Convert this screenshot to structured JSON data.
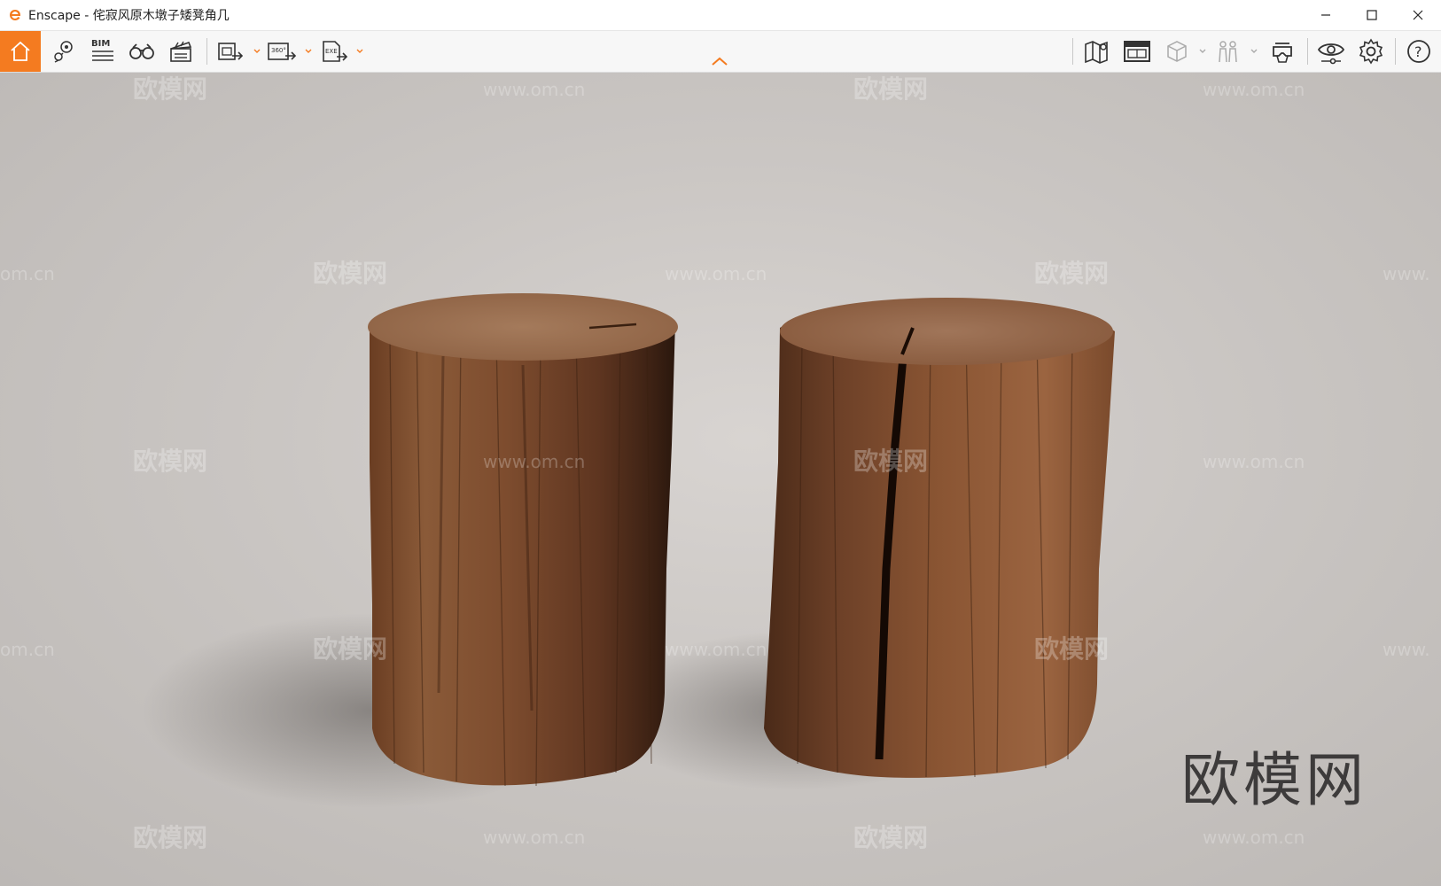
{
  "window": {
    "app_name": "Enscape",
    "separator": " - ",
    "document_title": "侘寂风原木墩子矮凳角几",
    "controls": [
      "minimize-icon",
      "maximize-icon",
      "close-icon"
    ]
  },
  "toolbar": {
    "accent_color": "#f47b20",
    "left_buttons": [
      {
        "name": "home-icon"
      },
      {
        "name": "map-pin-views-icon"
      },
      {
        "name": "bim-icon",
        "label": "BIM"
      },
      {
        "name": "binoculars-icon"
      },
      {
        "name": "clapperboard-icon"
      },
      {
        "name": "screenshot-export-icon",
        "has_dropdown": true
      },
      {
        "name": "panorama-export-icon",
        "label": "360°",
        "has_dropdown": true
      },
      {
        "name": "exe-export-icon",
        "label": "EXE",
        "has_dropdown": true
      }
    ],
    "right_buttons": [
      {
        "name": "map-icon"
      },
      {
        "name": "asset-library-icon"
      },
      {
        "name": "cube-icon",
        "has_dropdown": true
      },
      {
        "name": "people-icon",
        "has_dropdown": true
      },
      {
        "name": "vr-headset-icon"
      },
      {
        "name": "eye-icon"
      },
      {
        "name": "settings-icon"
      },
      {
        "name": "help-icon",
        "label": "?"
      }
    ]
  },
  "viewport": {
    "watermark_text": "欧模网",
    "watermark_url": "www.om.cn",
    "watermark_url_partial": "om.cn",
    "watermark_url_prefix": "www.",
    "brand_watermark": "欧模网"
  }
}
